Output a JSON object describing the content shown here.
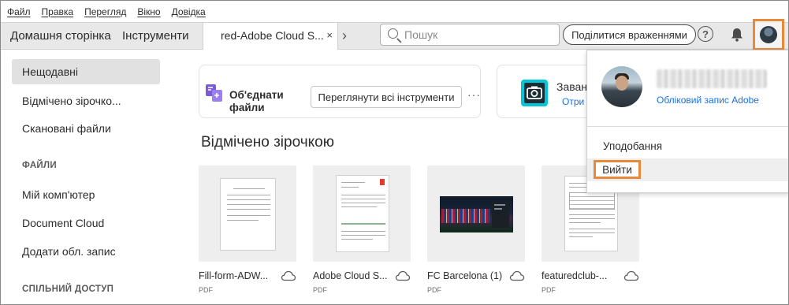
{
  "menubar": {
    "items": [
      "Файл",
      "Правка",
      "Перегляд",
      "Вікно",
      "Довідка"
    ]
  },
  "tabbar": {
    "home": "Домашня сторінка",
    "tools": "Інструменти",
    "doc_tab": "red-Adobe Cloud S...",
    "close": "×",
    "next": "›",
    "search_placeholder": "Пошук",
    "share_button": "Поділитися враженнями",
    "help": "?"
  },
  "sidebar": {
    "items": [
      "Нещодавні",
      "Відмічено зірочко...",
      "Скановані файли"
    ],
    "files_heading": "ФАЙЛИ",
    "file_items": [
      "Мій комп'ютер",
      "Document Cloud",
      "Додати обл. запис"
    ],
    "shared_heading": "СПІЛЬНИЙ ДОСТУП"
  },
  "main": {
    "combine_label": "Об'єднати файли",
    "view_tools_button": "Переглянути всі інструменти",
    "more": "···",
    "card2_title": "Заванта",
    "card2_link": "Отри",
    "section_title": "Відмічено зірочкою",
    "files": [
      {
        "name": "Fill-form-ADW...",
        "type": "PDF"
      },
      {
        "name": "Adobe Cloud S...",
        "type": "PDF"
      },
      {
        "name": "FC Barcelona (1)",
        "type": "PDF"
      },
      {
        "name": "featuredclub-...",
        "type": "PDF"
      }
    ]
  },
  "dropdown": {
    "account_link": "Обліковий запис Adobe",
    "preferences": "Уподобання",
    "logout": "Вийти"
  },
  "colors": {
    "highlight_orange": "#e8883a",
    "link_blue": "#1473e6",
    "combine_icon": "#7b5bd6",
    "scan_icon": "#00c6d8"
  }
}
